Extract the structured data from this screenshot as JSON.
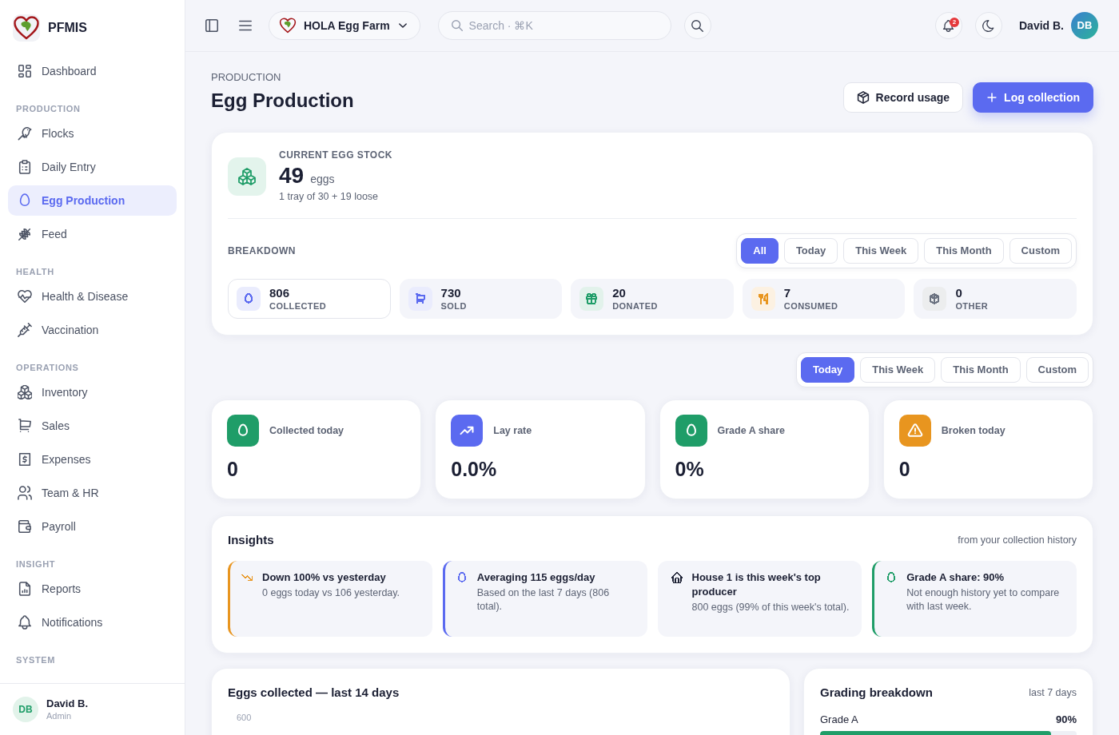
{
  "sidebar": {
    "brand": "PFMIS",
    "sections": [
      {
        "items": [
          {
            "label": "Dashboard",
            "selected": false
          }
        ]
      },
      {
        "title": "PRODUCTION",
        "items": [
          {
            "label": "Flocks",
            "selected": false
          },
          {
            "label": "Daily Entry",
            "selected": false
          },
          {
            "label": "Egg Production",
            "selected": true
          },
          {
            "label": "Feed",
            "selected": false
          }
        ]
      },
      {
        "title": "HEALTH",
        "items": [
          {
            "label": "Health & Disease",
            "selected": false
          },
          {
            "label": "Vaccination",
            "selected": false
          }
        ]
      },
      {
        "title": "OPERATIONS",
        "items": [
          {
            "label": "Inventory",
            "selected": false
          },
          {
            "label": "Sales",
            "selected": false
          },
          {
            "label": "Expenses",
            "selected": false
          },
          {
            "label": "Team & HR",
            "selected": false
          },
          {
            "label": "Payroll",
            "selected": false
          }
        ]
      },
      {
        "title": "INSIGHT",
        "items": [
          {
            "label": "Reports",
            "selected": false
          },
          {
            "label": "Notifications",
            "selected": false
          }
        ]
      },
      {
        "title": "SYSTEM"
      }
    ],
    "user": {
      "initials": "DB",
      "name": "David B.",
      "role": "Admin"
    }
  },
  "topbar": {
    "farm": "HOLA Egg Farm",
    "search": {
      "placeholder": "Search · ⌘K"
    },
    "notification_count": "2",
    "user": {
      "name": "David B.",
      "initials": "DB"
    }
  },
  "page": {
    "eyebrow": "PRODUCTION",
    "title": "Egg Production",
    "actions": [
      {
        "label": "Record usage",
        "kind": "secondary"
      },
      {
        "label": "Log collection",
        "kind": "primary"
      }
    ]
  },
  "stock": {
    "label": "CURRENT EGG STOCK",
    "value": "49",
    "unit": "eggs",
    "detail": "1 tray of 30 + 19 loose",
    "breakdown": {
      "label": "BREAKDOWN",
      "filters": [
        {
          "label": "All",
          "selected": true
        },
        {
          "label": "Today",
          "selected": false
        },
        {
          "label": "This Week",
          "selected": false
        },
        {
          "label": "This Month",
          "selected": false
        },
        {
          "label": "Custom",
          "selected": false
        }
      ],
      "items": [
        {
          "value": "806",
          "label": "COLLECTED",
          "selected": true,
          "color": "#5b6af0"
        },
        {
          "value": "730",
          "label": "SOLD",
          "selected": false,
          "color": "#5b6af0"
        },
        {
          "value": "20",
          "label": "DONATED",
          "selected": false,
          "color": "#1f9d68"
        },
        {
          "value": "7",
          "label": "CONSUMED",
          "selected": false,
          "color": "#e8951f"
        },
        {
          "value": "0",
          "label": "OTHER",
          "selected": false,
          "color": "#6b7280"
        }
      ]
    }
  },
  "period_filters": [
    {
      "label": "Today",
      "selected": true
    },
    {
      "label": "This Week",
      "selected": false
    },
    {
      "label": "This Month",
      "selected": false
    },
    {
      "label": "Custom",
      "selected": false
    }
  ],
  "stat_cards": [
    {
      "label": "Collected today",
      "value": "0",
      "color": "#1f9d68"
    },
    {
      "label": "Lay rate",
      "value": "0.0%",
      "color": "#5b6af0"
    },
    {
      "label": "Grade A share",
      "value": "0%",
      "color": "#1f9d68"
    },
    {
      "label": "Broken today",
      "value": "0",
      "color": "#e8951f"
    }
  ],
  "insights": {
    "title": "Insights",
    "note": "from your collection history",
    "items": [
      {
        "title": "Down 100% vs yesterday",
        "text": "0 eggs today vs 106 yesterday.",
        "color": "#e8951f",
        "accent_border": true
      },
      {
        "title": "Averaging 115 eggs/day",
        "text": "Based on the last 7 days (806 total).",
        "color": "#5b6af0",
        "accent_border": true
      },
      {
        "title": "House 1 is this week's top producer",
        "text": "800 eggs (99% of this week's total).",
        "color": "#1e2235",
        "accent_border": false
      },
      {
        "title": "Grade A share: 90%",
        "text": "Not enough history yet to compare with last week.",
        "color": "#1f9d68",
        "accent_border": true
      }
    ]
  },
  "eggs_chart": {
    "title": "Eggs collected — last 14 days",
    "y_tick_label": "600"
  },
  "grading": {
    "title": "Grading breakdown",
    "period": "last 7 days",
    "rows": [
      {
        "label": "Grade A",
        "reading": "90%",
        "level": 0.9
      }
    ]
  }
}
